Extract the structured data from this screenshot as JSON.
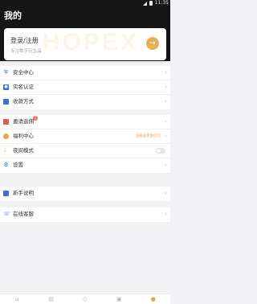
{
  "status_bar": {
    "time": "11:35"
  },
  "header": {
    "title": "我的"
  },
  "login_card": {
    "title": "登录/注册",
    "subtitle": "专注数字衍生品",
    "watermark": "HOPEX",
    "arrow_icon": "arrow-right-icon"
  },
  "groups": [
    {
      "items": [
        {
          "label": "安全中心",
          "icon": "shield-icon",
          "color": "#3b6fd6"
        },
        {
          "label": "实名认证",
          "icon": "id-card-icon",
          "color": "#3b6fd6"
        },
        {
          "label": "收款方式",
          "icon": "wallet-icon",
          "color": "#3b6fd6"
        }
      ]
    },
    {
      "items": [
        {
          "label": "邀请返佣",
          "icon": "gift-icon",
          "color": "#e25b4a",
          "badge": "1"
        },
        {
          "label": "福利中心",
          "icon": "coin-icon",
          "color": "#e7a93f",
          "note": "注册送现金红包"
        },
        {
          "label": "夜间模式",
          "icon": "moon-icon",
          "color": "#e7b93f",
          "toggle": false
        },
        {
          "label": "设置",
          "icon": "gear-icon",
          "color": "#3b6fd6"
        }
      ]
    },
    {
      "items": [
        {
          "label": "新手说明",
          "icon": "book-icon",
          "color": "#3b6fd6"
        }
      ]
    },
    {
      "items": [
        {
          "label": "在线客服",
          "icon": "headset-icon",
          "color": "#3b6fd6"
        }
      ]
    }
  ],
  "tabbar": {
    "tabs": [
      {
        "icon": "home-icon",
        "active": false
      },
      {
        "icon": "market-icon",
        "active": false
      },
      {
        "icon": "trade-icon",
        "active": false
      },
      {
        "icon": "asset-icon",
        "active": false
      },
      {
        "icon": "profile-icon",
        "active": true
      }
    ],
    "active_color": "#e0a548"
  },
  "colors": {
    "header_bg": "#161616",
    "accent": "#e7b056",
    "page_bg": "#f2f2f4"
  }
}
